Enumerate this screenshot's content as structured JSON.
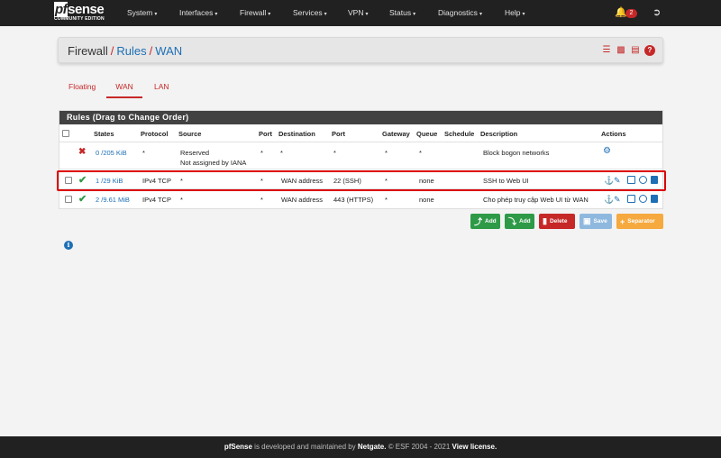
{
  "brand": {
    "logo_prefix": "pf",
    "logo_suffix": "sense",
    "edition": "COMMUNITY EDITION"
  },
  "nav": {
    "items": [
      {
        "label": "System"
      },
      {
        "label": "Interfaces"
      },
      {
        "label": "Firewall"
      },
      {
        "label": "Services"
      },
      {
        "label": "VPN"
      },
      {
        "label": "Status"
      },
      {
        "label": "Diagnostics"
      },
      {
        "label": "Help"
      }
    ],
    "caret": "▾",
    "notification_count": "2"
  },
  "breadcrumb": {
    "part1": "Firewall",
    "part2": "Rules",
    "part3": "WAN",
    "separator": "/"
  },
  "tabs": [
    {
      "label": "Floating"
    },
    {
      "label": "WAN"
    },
    {
      "label": "LAN"
    }
  ],
  "panel": {
    "title": "Rules (Drag to Change Order)"
  },
  "columns": [
    "States",
    "Protocol",
    "Source",
    "Port",
    "Destination",
    "Port",
    "Gateway",
    "Queue",
    "Schedule",
    "Description",
    "Actions"
  ],
  "rows": [
    {
      "states": "0 /205 KiB",
      "protocol": "*",
      "source": "Reserved",
      "source2": "Not assigned by IANA",
      "src_port": "*",
      "destination": "*",
      "dst_port": "*",
      "gateway": "*",
      "queue": "*",
      "schedule": "",
      "description": "Block bogon networks",
      "status": "blocked"
    },
    {
      "states": "1 /29 KiB",
      "protocol": "IPv4 TCP",
      "source": "*",
      "src_port": "*",
      "destination": "WAN address",
      "dst_port": "22 (SSH)",
      "gateway": "*",
      "queue": "none",
      "schedule": "",
      "description": "SSH to Web UI",
      "status": "pass"
    },
    {
      "states": "2 /9.61 MiB",
      "protocol": "IPv4 TCP",
      "source": "*",
      "src_port": "*",
      "destination": "WAN address",
      "dst_port": "443 (HTTPS)",
      "gateway": "*",
      "queue": "none",
      "schedule": "",
      "description": "Cho phép truy cập Web UI từ WAN",
      "status": "pass"
    }
  ],
  "buttons": {
    "add_top": "Add",
    "add_bottom": "Add",
    "delete": "Delete",
    "save": "Save",
    "separator": "Separator"
  },
  "footer": {
    "brand": "pfSense",
    "text1": " is developed and maintained by ",
    "company": "Netgate.",
    "text2": " © ESF 2004 - 2021 ",
    "license": "View license."
  },
  "colors": {
    "accent": "#c62828",
    "link": "#1e6fb5",
    "pass": "#2e9a47",
    "navbar": "#212121"
  }
}
